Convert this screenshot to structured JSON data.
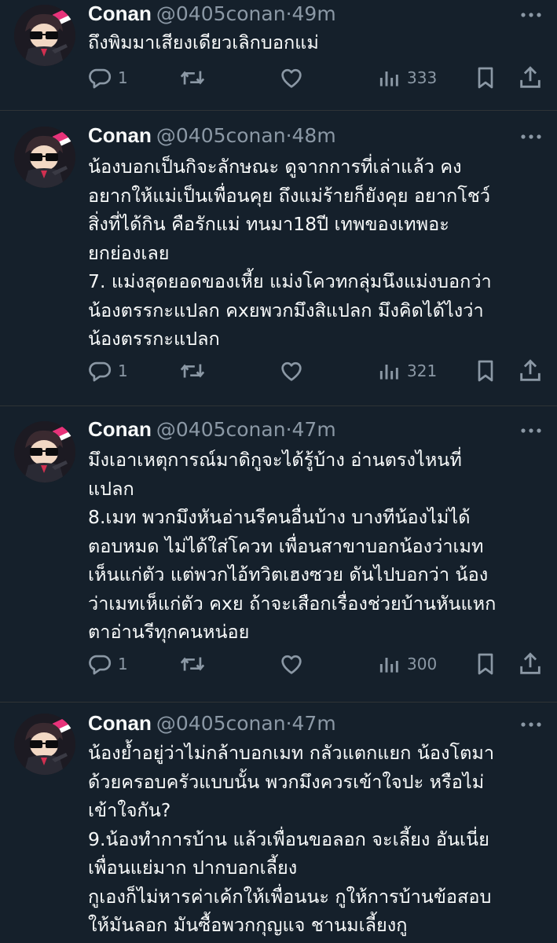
{
  "tweets": [
    {
      "name": "Conan",
      "handle": "@0405conan",
      "time": "49m",
      "text": "ถึงพิมมาเสียงเดียวเลิกบอกแม่",
      "replies": "1",
      "views": "333"
    },
    {
      "name": "Conan",
      "handle": "@0405conan",
      "time": "48m",
      "text": "น้องบอกเป็นกิจะลักษณะ ดูจากการที่เล่าแล้ว คง\nอยากให้แม่เป็นเพื่อนคุย ถึงแม่ร้ายก็ยังคุย อยากโชว์\nสิ่งที่ได้กิน คือรักแม่ ทนมา18ปี เทพของเทพอะ\nยกย่องเลย\n7. แม่งสุดยอดของเหี้ย แม่งโควทกลุ่มนึงแม่งบอกว่า\nน้องตรรกะแปลก คxยพวกมึงสิแปลก มึงคิดได้ไงว่า\nน้องตรรกะแปลก",
      "replies": "1",
      "views": "321"
    },
    {
      "name": "Conan",
      "handle": "@0405conan",
      "time": "47m",
      "text": "มึงเอาเหตุการณ์มาดิกูจะได้รู้บ้าง อ่านตรงไหนที่\nแปลก\n8.เมท พวกมึงหันอ่านรีคนอื่นบ้าง บางทีน้องไม่ได้\nตอบหมด ไม่ได้ใส่โควท เพื่อนสาขาบอกน้องว่าเมท\nเห็นแก่ตัว แต่พวกไอ้ทวิตเฮงซวย ดันไปบอกว่า น้อง\nว่าเมทเห็แก่ตัว คxย ถ้าจะเสือกเรื่องช่วยบ้านหันแหก\nตาอ่านรีทุกคนหน่อย",
      "replies": "1",
      "views": "300"
    },
    {
      "name": "Conan",
      "handle": "@0405conan",
      "time": "47m",
      "text": "น้องย้ำอยู่ว่าไม่กล้าบอกเมท กลัวแตกแยก น้องโตมา\nด้วยครอบครัวแบบนั้น พวกมึงควรเข้าใจปะ หรือไม่\nเข้าใจกัน?\n9.น้องทำการบ้าน แล้วเพื่อนขอลอก จะเลี้ยง อันเนี่ย\nเพื่อนแย่มาก ปากบอกเลี้ยง\nกูเองก็ไม่หารค่าเค้กให้เพื่อนนะ กูให้การบ้านข้อสอบ\nให้มันลอก มันซื้อพวกกุญแจ ชานมเลี้ยงกู",
      "replies": "",
      "views": ""
    }
  ],
  "separator": "·",
  "icons": {
    "more": "more-icon",
    "reply": "reply-icon",
    "retweet": "retweet-icon",
    "like": "like-icon",
    "views": "views-icon",
    "bookmark": "bookmark-icon",
    "share": "share-icon"
  },
  "colors": {
    "background": "#15202b",
    "text": "#f7f9f9",
    "secondary": "#8b98a5",
    "divider": "#2f3336"
  }
}
